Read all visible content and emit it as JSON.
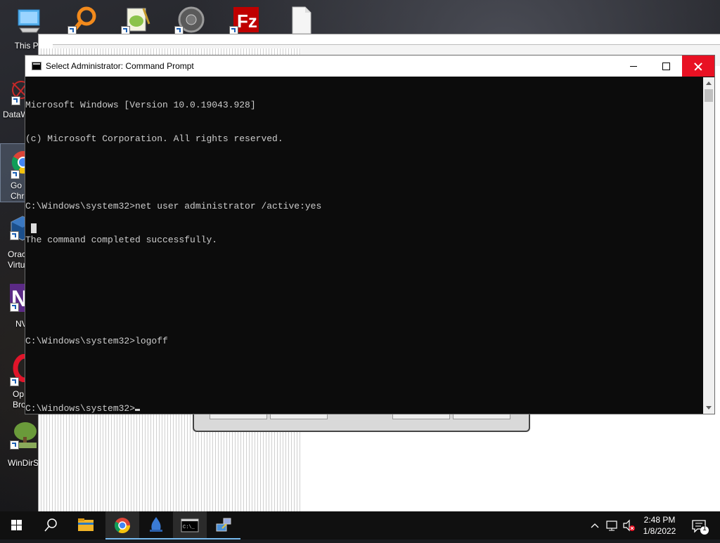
{
  "desktop": {
    "icons": [
      {
        "label": "This PC",
        "icon": "this-pc-icon"
      },
      {
        "label": "",
        "icon": "search-everything-icon"
      },
      {
        "label": "",
        "icon": "notepad-plus-plus-icon"
      },
      {
        "label": "",
        "icon": "installer-disc-icon"
      },
      {
        "label": "",
        "icon": "filezilla-icon"
      },
      {
        "label": "",
        "icon": "blank-file-icon"
      },
      {
        "label": "DataW",
        "icon": "datawarrior-icon"
      },
      {
        "label": "Go\nChr",
        "icon": "chrome-icon"
      },
      {
        "label": "Orac\nVirtu",
        "icon": "virtualbox-icon"
      },
      {
        "label": "NV",
        "icon": "nvda-icon"
      },
      {
        "label": "Op\nBro",
        "icon": "opera-icon"
      },
      {
        "label": "WinDirS",
        "icon": "windirstat-icon"
      }
    ]
  },
  "cmd": {
    "title": "Select Administrator: Command Prompt",
    "lines": [
      "Microsoft Windows [Version 10.0.19043.928]",
      "(c) Microsoft Corporation. All rights reserved.",
      "",
      "C:\\Windows\\system32>net user administrator /active:yes",
      "The command completed successfully.",
      "",
      "",
      "C:\\Windows\\system32>logoff",
      "",
      "C:\\Windows\\system32>"
    ]
  },
  "taskbar": {
    "items": [
      "start-icon",
      "search-icon",
      "file-explorer-icon",
      "chrome-icon",
      "sign-icon",
      "command-prompt-icon",
      "network-icon"
    ],
    "clock": {
      "time": "2:48 PM",
      "date": "1/8/2022"
    },
    "notification_count": "1"
  }
}
